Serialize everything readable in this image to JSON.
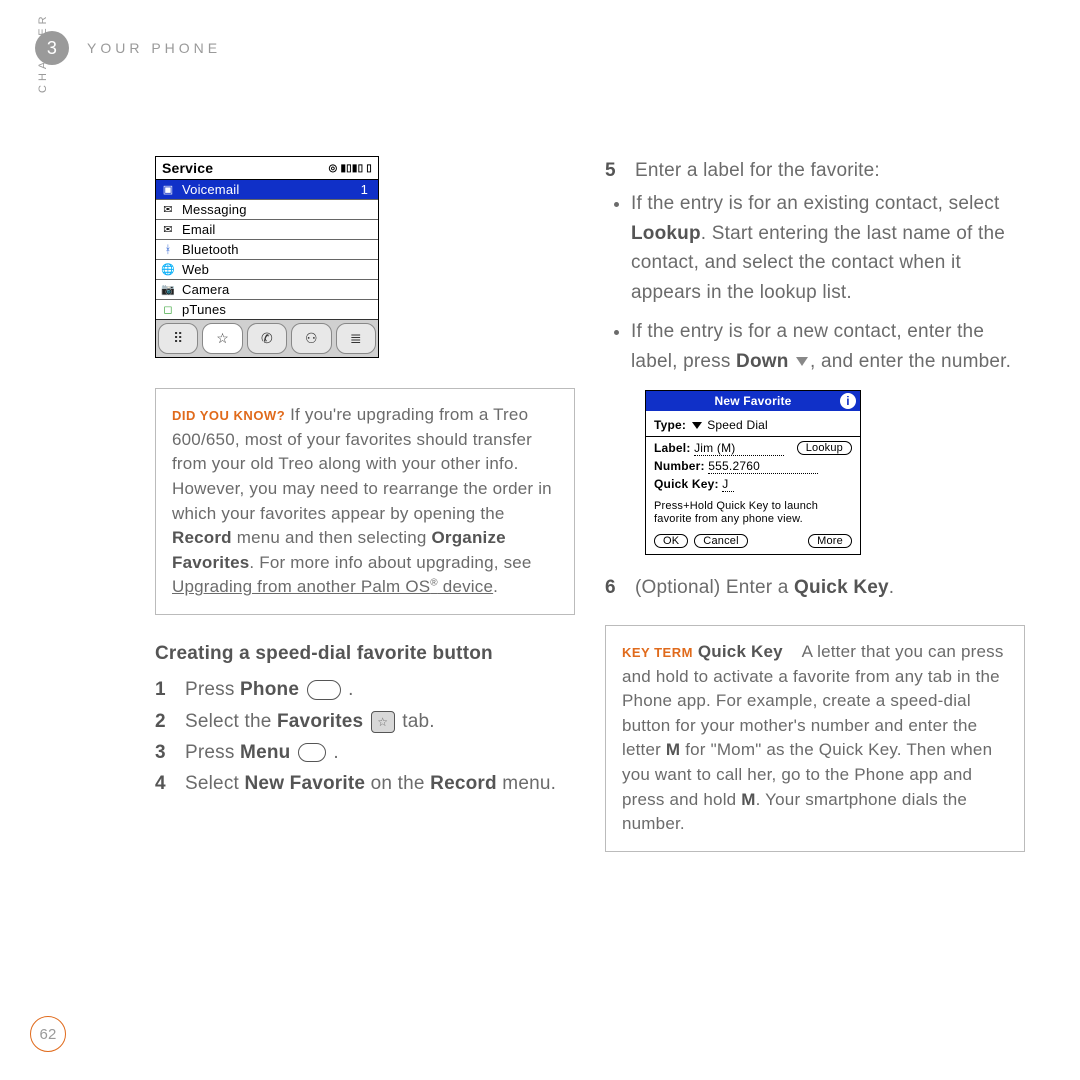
{
  "header": {
    "chapter_num": "3",
    "title": "YOUR PHONE",
    "side_label": "CHAPTER"
  },
  "page_number": "62",
  "shot1": {
    "title": "Service",
    "items": [
      {
        "label": "Voicemail",
        "badge": "1",
        "selected": true
      },
      {
        "label": "Messaging"
      },
      {
        "label": "Email"
      },
      {
        "label": "Bluetooth"
      },
      {
        "label": "Web"
      },
      {
        "label": "Camera"
      },
      {
        "label": "pTunes"
      }
    ]
  },
  "callout1": {
    "lead": "DID YOU KNOW?",
    "text_a": "If you're upgrading from a Treo 600/650, most of your favorites should transfer from your old Treo along with your other info. However, you may need to rearrange the order in which your favorites appear by opening the ",
    "bold_a": "Record",
    "text_b": " menu and then selecting ",
    "bold_b": "Organize Favorites",
    "text_c": ". For more info about upgrading, see ",
    "link": "Upgrading from another Palm OS",
    "link_tail": " device",
    "period": "."
  },
  "section_heading": "Creating a speed-dial favorite button",
  "steps_left": {
    "s1_a": "Press ",
    "s1_b": "Phone",
    "s2_a": "Select the ",
    "s2_b": "Favorites",
    "s2_c": " tab.",
    "s3_a": "Press ",
    "s3_b": "Menu",
    "s4_a": "Select ",
    "s4_b": "New Favorite",
    "s4_c": " on the ",
    "s4_d": "Record",
    "s4_e": " menu."
  },
  "step5": {
    "intro": "Enter a label for the favorite:",
    "b1_a": "If the entry is for an existing contact, select ",
    "b1_b": "Lookup",
    "b1_c": ". Start entering the last name of the contact, and select the contact when it appears in the lookup list.",
    "b2_a": "If the entry is for a new contact, enter the label, press ",
    "b2_b": "Down",
    "b2_c": ", and enter the number."
  },
  "shot2": {
    "title": "New Favorite",
    "type_label": "Type:",
    "type_value": "Speed Dial",
    "label_label": "Label:",
    "label_value": "Jim (M)",
    "lookup_btn": "Lookup",
    "number_label": "Number:",
    "number_value": "555.2760",
    "quick_label": "Quick Key:",
    "quick_value": "J",
    "note": "Press+Hold Quick Key to launch favorite from any phone view.",
    "ok": "OK",
    "cancel": "Cancel",
    "more": "More"
  },
  "step6": {
    "a": "(Optional)  Enter a ",
    "b": "Quick Key",
    "c": "."
  },
  "callout2": {
    "lead": "KEY TERM",
    "term": "Quick Key",
    "text": "A letter that you can press and hold to activate a favorite from any tab in the Phone app. For example, create a speed-dial button for your mother's number and enter the letter ",
    "m1": "M",
    "t2": " for \"Mom\" as the Quick Key. Then when you want to call her, go to the Phone app and press and hold ",
    "m2": "M",
    "t3": ". Your smartphone dials the number."
  }
}
